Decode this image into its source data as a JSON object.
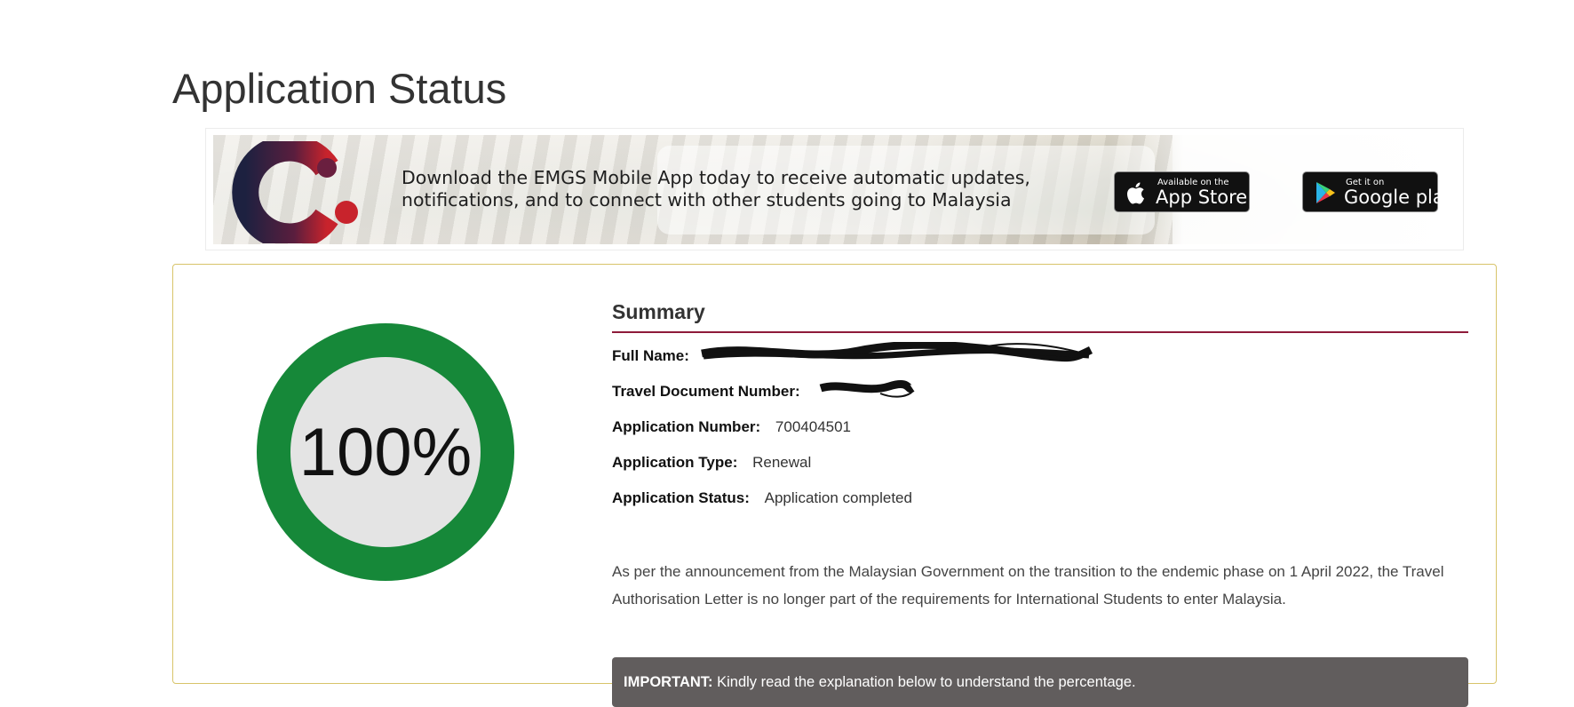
{
  "page": {
    "title": "Application Status"
  },
  "banner": {
    "text": "Download the EMGS Mobile App today to receive automatic updates, notifications, and to connect with other students going to Malaysia",
    "app_store": {
      "small": "Available on the",
      "big": "App Store",
      "icon": "apple-icon"
    },
    "google_play": {
      "small": "Get it on",
      "big": "Google play",
      "icon": "play-icon"
    }
  },
  "progress": {
    "label": "100%",
    "value": 1.0,
    "color": "#168839",
    "track_fill": "#e4e4e4"
  },
  "summary": {
    "heading": "Summary",
    "full_name_label": "Full Name",
    "travel_doc_label": "Travel Document Number",
    "app_number_label": "Application Number",
    "app_number_value": "700404501",
    "app_type_label": "Application Type",
    "app_type_value": "Renewal",
    "app_status_label": "Application Status",
    "app_status_value": "Application completed",
    "notice": "As per the announcement from the Malaysian Government on the transition to the endemic phase on 1 April 2022, the Travel Authorisation Letter is no longer part of the requirements for International Students to enter Malaysia.",
    "important_label": "IMPORTANT:",
    "important_text": "Kindly read the explanation below to understand the percentage."
  },
  "colors": {
    "accent_rule": "#8e1b3a",
    "card_border": "#d8c46a",
    "important_bg": "#615d5d"
  }
}
